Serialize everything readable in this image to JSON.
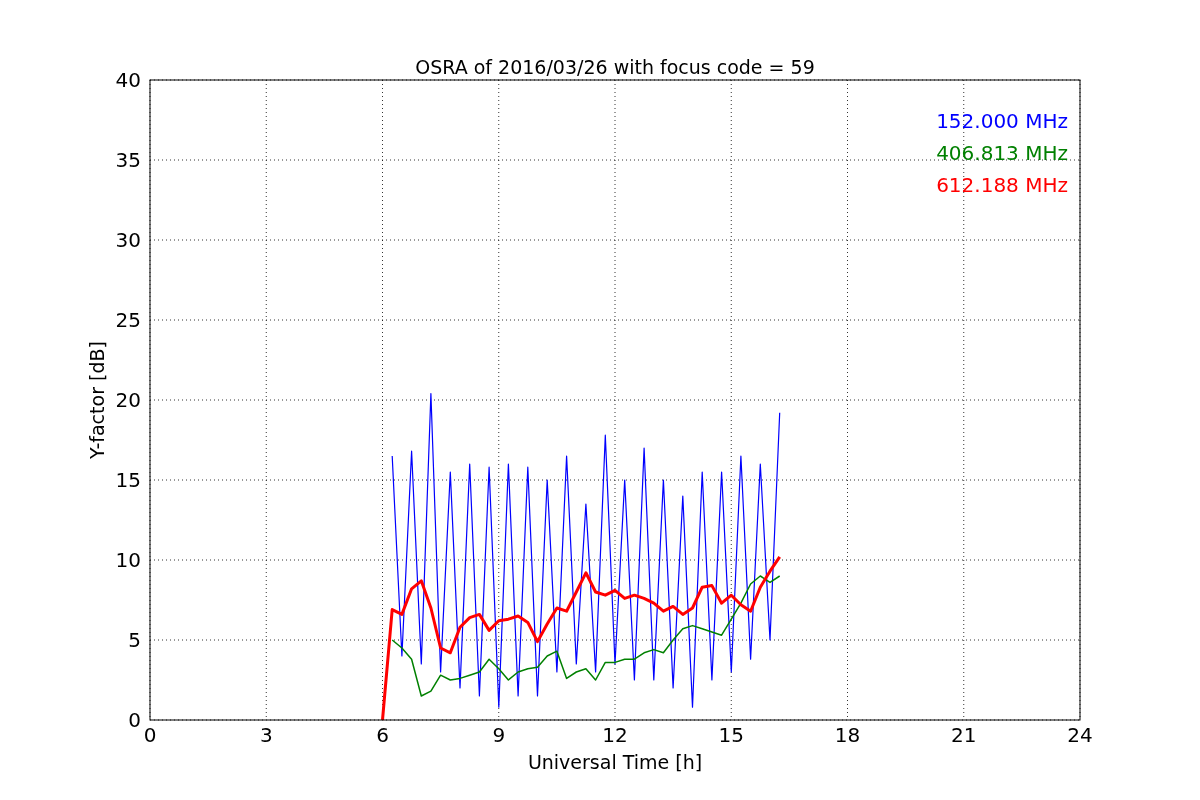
{
  "chart_data": {
    "type": "line",
    "title": "OSRA of 2016/03/26 with focus code = 59",
    "xlabel": "Universal Time [h]",
    "ylabel": "Y-factor [dB]",
    "x": [
      6.0,
      6.25,
      6.5,
      6.75,
      7.0,
      7.25,
      7.5,
      7.75,
      8.0,
      8.25,
      8.5,
      8.75,
      9.0,
      9.25,
      9.5,
      9.75,
      10.0,
      10.25,
      10.5,
      10.75,
      11.0,
      11.25,
      11.5,
      11.75,
      12.0,
      12.25,
      12.5,
      12.75,
      13.0,
      13.25,
      13.5,
      13.75,
      14.0,
      14.25,
      14.5,
      14.75,
      15.0,
      15.25,
      15.5,
      15.75,
      16.0,
      16.25
    ],
    "series": [
      {
        "name": "152.000 MHz",
        "color": "#0000ff",
        "values": [
          null,
          16.5,
          4.0,
          16.8,
          3.5,
          20.4,
          3.0,
          15.5,
          2.0,
          16.0,
          1.5,
          15.8,
          0.8,
          16.0,
          1.5,
          15.8,
          1.5,
          15.0,
          3.0,
          16.5,
          3.5,
          13.5,
          3.0,
          17.8,
          3.5,
          15.0,
          2.5,
          17.0,
          2.5,
          15.0,
          2.0,
          14.0,
          0.8,
          15.5,
          2.5,
          15.5,
          3.0,
          16.5,
          3.8,
          16.0,
          5.0,
          19.2
        ]
      },
      {
        "name": "406.813 MHz",
        "color": "#008000",
        "values": [
          null,
          5.0,
          4.5,
          3.8,
          1.5,
          1.8,
          2.8,
          2.5,
          2.6,
          2.8,
          3.0,
          3.8,
          3.2,
          2.5,
          3.0,
          3.2,
          3.3,
          4.0,
          4.3,
          2.6,
          3.0,
          3.2,
          2.5,
          3.6,
          3.6,
          3.8,
          3.8,
          4.2,
          4.4,
          4.2,
          5.0,
          5.7,
          5.9,
          5.7,
          5.5,
          5.3,
          6.3,
          7.3,
          8.5,
          9.0,
          8.6,
          9.0
        ]
      },
      {
        "name": "612.188 MHz",
        "color": "#ff0000",
        "values": [
          0,
          6.9,
          6.6,
          8.2,
          8.7,
          7.0,
          4.5,
          4.2,
          5.8,
          6.4,
          6.6,
          5.6,
          6.2,
          6.3,
          6.5,
          6.1,
          4.9,
          6.0,
          7.0,
          6.8,
          8.0,
          9.2,
          8.0,
          7.8,
          8.1,
          7.6,
          7.8,
          7.6,
          7.3,
          6.8,
          7.1,
          6.6,
          7.0,
          8.3,
          8.4,
          7.3,
          7.8,
          7.2,
          6.8,
          8.3,
          9.3,
          10.2
        ]
      }
    ],
    "xlim": [
      0,
      24
    ],
    "ylim": [
      0,
      40
    ],
    "xticks": [
      0,
      3,
      6,
      9,
      12,
      15,
      18,
      21,
      24
    ],
    "yticks": [
      0,
      5,
      10,
      15,
      20,
      25,
      30,
      35,
      40
    ],
    "grid": true
  }
}
